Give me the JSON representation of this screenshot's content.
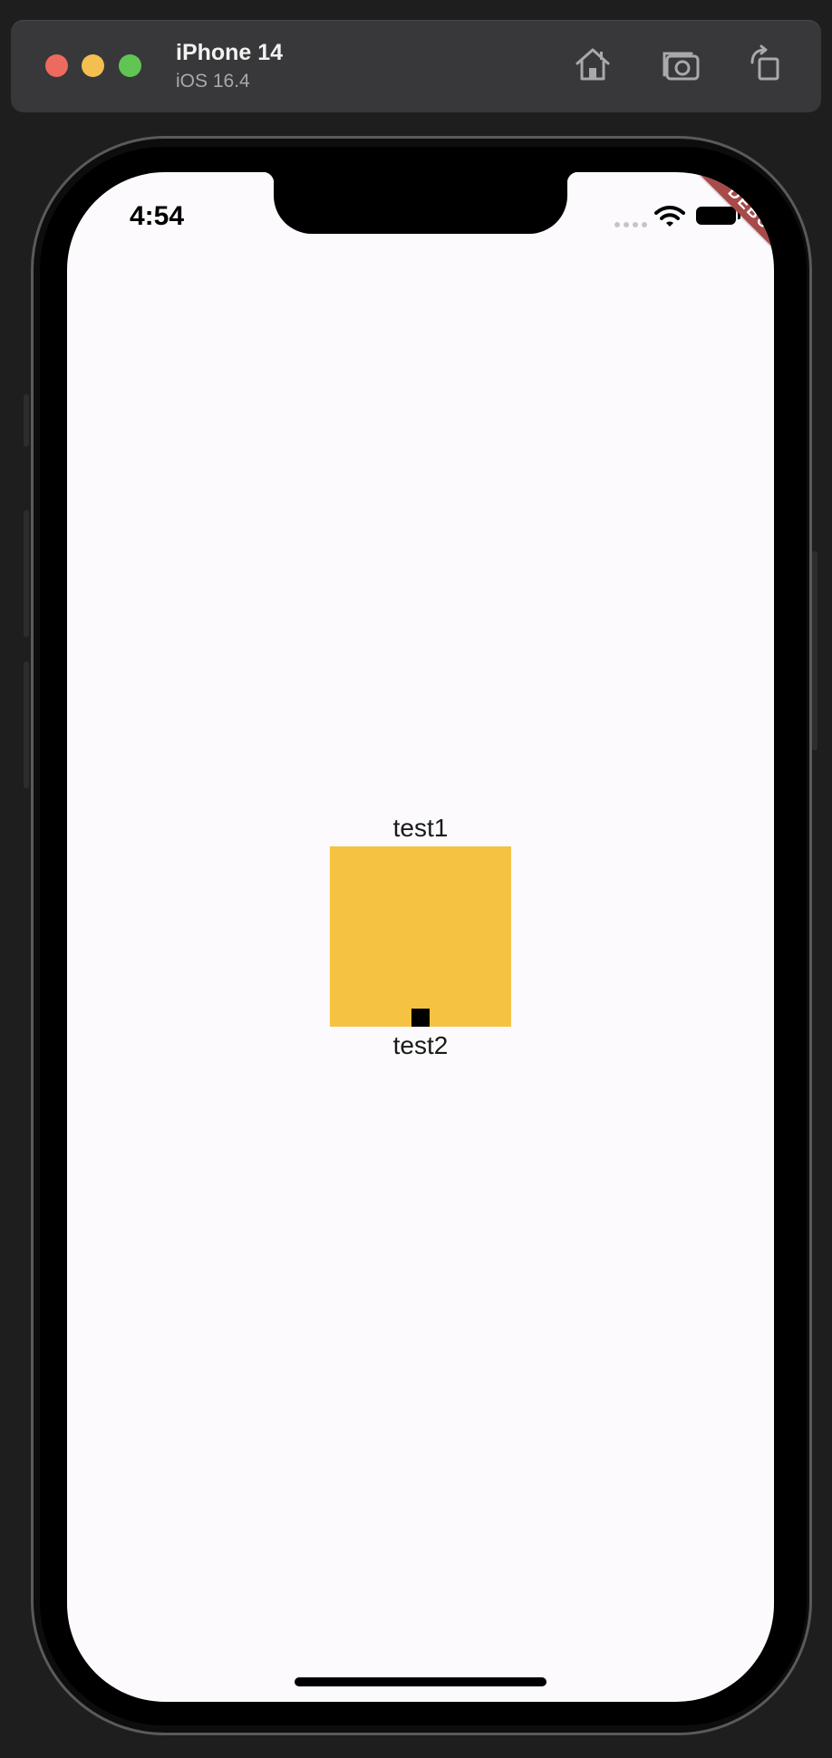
{
  "simulator": {
    "device_name": "iPhone 14",
    "os_version": "iOS 16.4",
    "toolbar_icons": [
      "home-icon",
      "screenshot-icon",
      "rotate-icon"
    ],
    "traffic_lights": {
      "close": "#ed6a5e",
      "minimize": "#f5bf4f",
      "zoom": "#61c554"
    }
  },
  "status_bar": {
    "time": "4:54",
    "icons": [
      "signal-icon",
      "wifi-icon",
      "battery-icon"
    ]
  },
  "debug_banner": {
    "label": "DEBUG",
    "color": "#a84a4a"
  },
  "content": {
    "label_top": "test1",
    "label_bottom": "test2",
    "box_color": "#f5c242",
    "background_color": "#fcfafd"
  }
}
